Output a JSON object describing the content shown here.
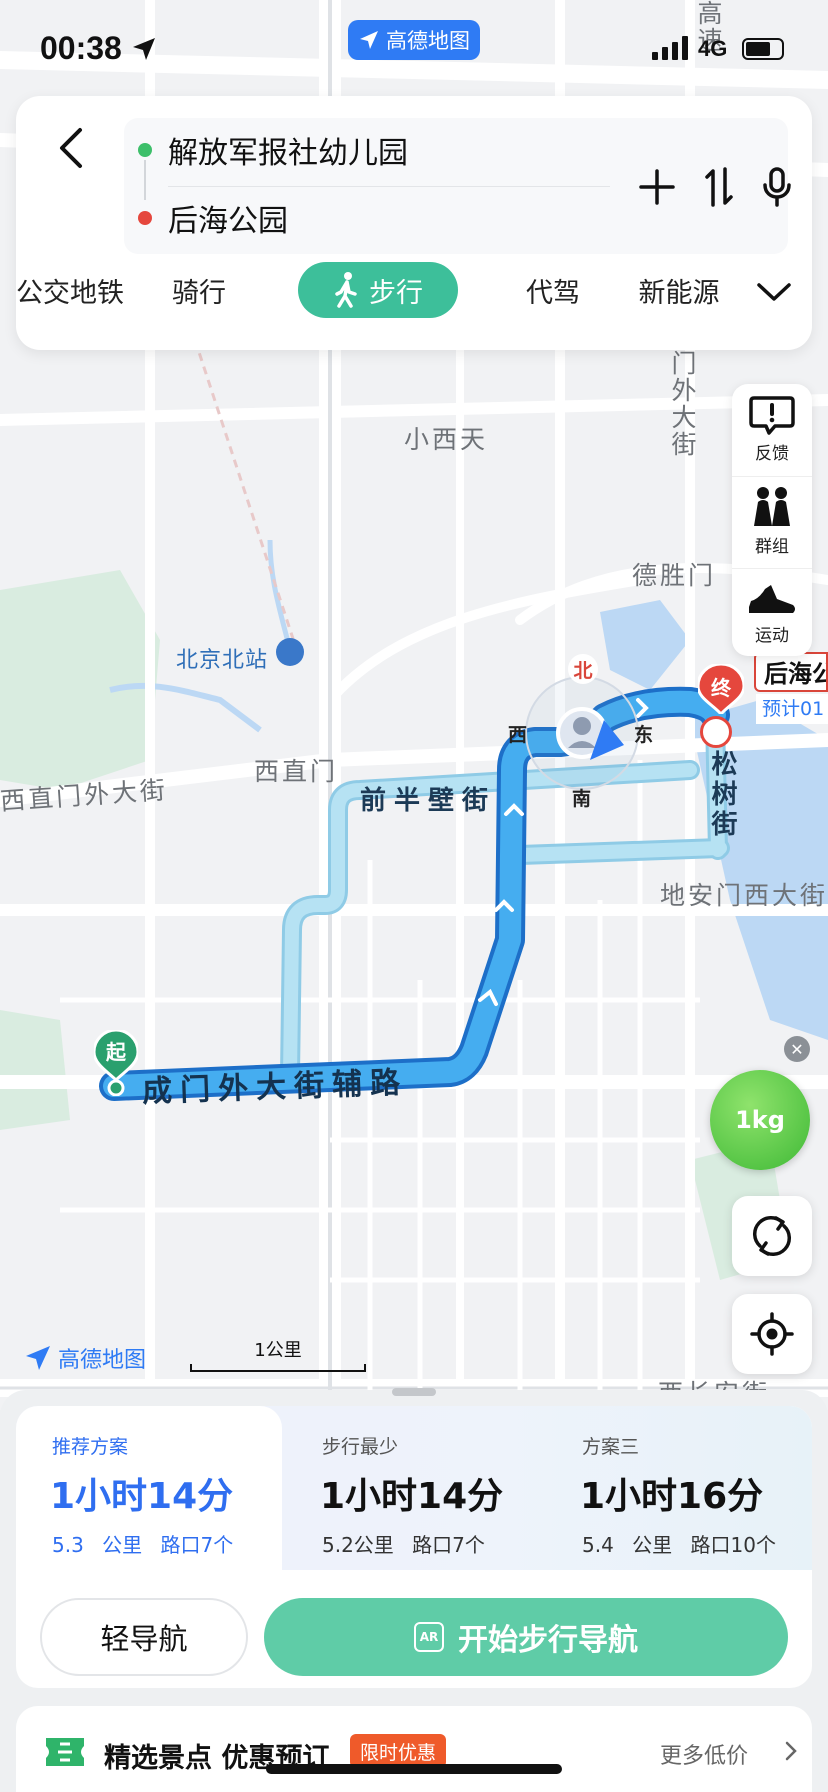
{
  "status_bar": {
    "time": "00:38",
    "network": "4G",
    "app_badge": "高德地图"
  },
  "route": {
    "start": "解放军报社幼儿园",
    "end": "后海公园"
  },
  "modes": [
    {
      "label": "公交地铁"
    },
    {
      "label": "骑行"
    },
    {
      "label": "步行"
    },
    {
      "label": "代驾"
    },
    {
      "label": "新能源"
    }
  ],
  "active_mode": "步行",
  "side_tools": [
    {
      "label": "反馈",
      "icon": "feedback-icon"
    },
    {
      "label": "群组",
      "icon": "group-icon"
    },
    {
      "label": "运动",
      "icon": "sport-shoe-icon"
    }
  ],
  "map": {
    "labels": {
      "xiaoxitian": "小西天",
      "deshengmen": "德胜门",
      "beijing_north": "北京北站",
      "xizhimen": "西直门",
      "xizhimenwai": "西直门外大街",
      "dianmen_west": "地安门西大街",
      "xichangan": "西长安街",
      "deshengmennei": "门外大街",
      "top_vertical": "高速"
    },
    "road_labels": {
      "qianbanbi": "前半壁街",
      "fuchengmen": "成门外大街辅路",
      "songshu": "松树街"
    },
    "compass": {
      "north": "北",
      "south": "南",
      "east": "东",
      "west": "西"
    },
    "start_marker": "起",
    "end_marker": "终",
    "destination_label": "后海公",
    "destination_eta": "预计01",
    "carbon": "1kg",
    "scale": "1公里",
    "logo": "高德地图"
  },
  "plans": [
    {
      "name": "推荐方案",
      "time": "1小时14分",
      "distance": "5.3 公里",
      "crossings": "路口7个"
    },
    {
      "name": "步行最少",
      "time": "1小时14分",
      "distance": "5.2公里",
      "crossings": "路口7个"
    },
    {
      "name": "方案三",
      "time": "1小时16分",
      "distance": "5.4 公里",
      "crossings": "路口10个"
    }
  ],
  "buttons": {
    "lite_nav": "轻导航",
    "start_nav": "开始步行导航",
    "ar": "AR"
  },
  "promo": {
    "title": "精选景点 优惠预订",
    "tag": "限时优惠",
    "more": "更多低价"
  },
  "colors": {
    "accent_green": "#3dbf9a",
    "route_blue": "#3a9be8",
    "alt_route": "#a9d8ef",
    "plan_blue": "#2f6ef0",
    "destination_red": "#d9453a"
  }
}
